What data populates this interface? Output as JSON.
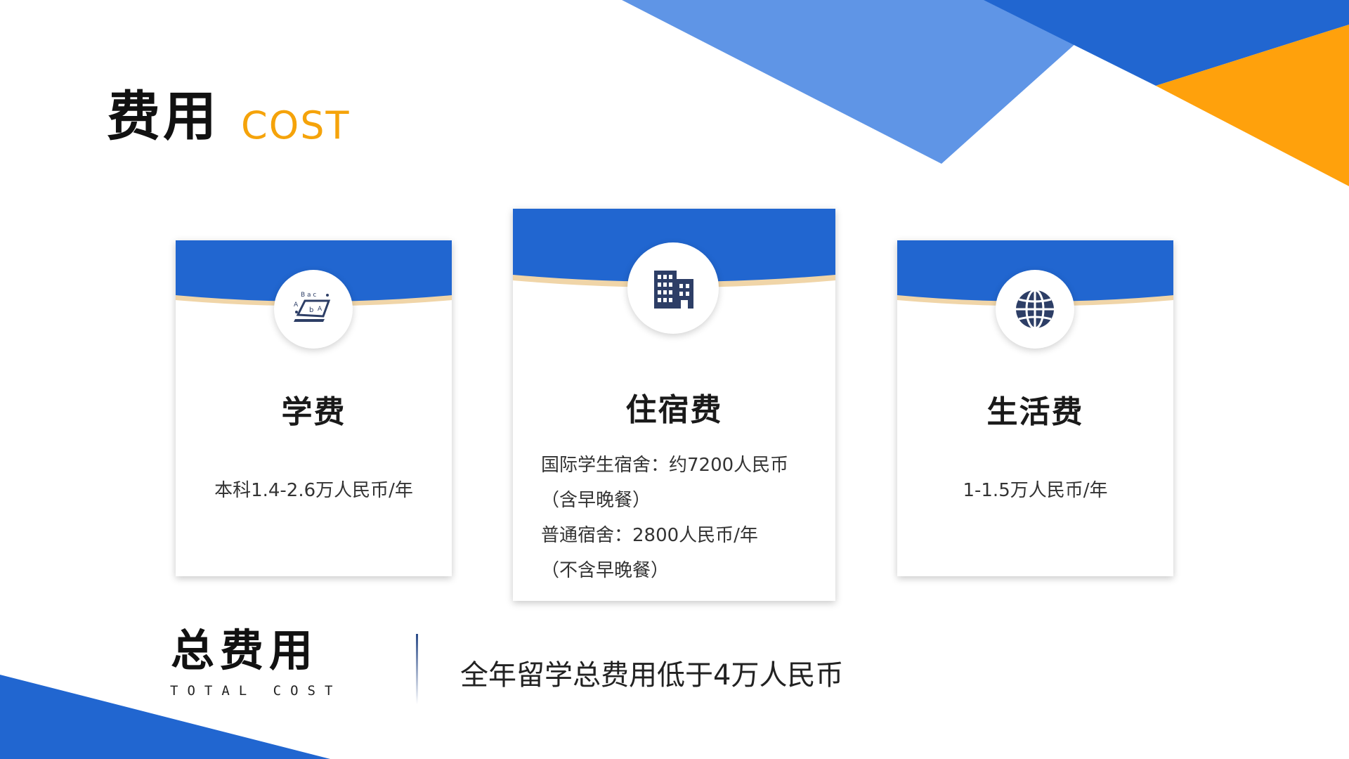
{
  "header": {
    "title_cn": "费用",
    "title_en": "COST"
  },
  "colors": {
    "blue": "#2166d0",
    "light_blue": "#5f95e6",
    "orange": "#ffa10c",
    "cream": "#f0d5a8"
  },
  "cards": [
    {
      "icon": "laptop-alphabet-icon",
      "title": "学费",
      "lines": [
        "本科1.4-2.6万人民币/年"
      ]
    },
    {
      "icon": "building-icon",
      "title": "住宿费",
      "lines": [
        "国际学生宿舍：约7200人民币",
        "（含早晚餐）",
        "普通宿舍：2800人民币/年",
        "（不含早晚餐）"
      ]
    },
    {
      "icon": "globe-icon",
      "title": "生活费",
      "lines": [
        "1-1.5万人民币/年"
      ]
    }
  ],
  "total": {
    "title_cn": "总费用",
    "title_en": "TOTAL COST",
    "text": "全年留学总费用低于4万人民币"
  }
}
